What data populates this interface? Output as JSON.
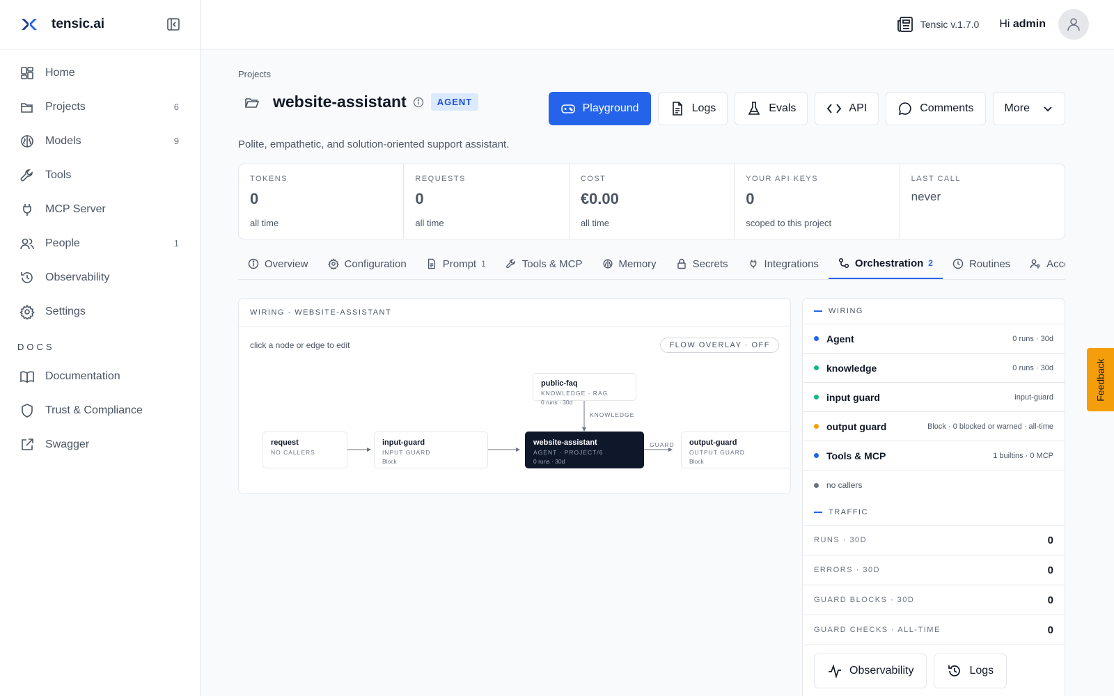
{
  "app": {
    "brand": "tensic.ai"
  },
  "topbar": {
    "version": "Tensic v.1.7.0",
    "greeting_prefix": "Hi",
    "user": "admin"
  },
  "sidebar": {
    "items": [
      {
        "label": "Home",
        "count": "",
        "icon": "home-icon"
      },
      {
        "label": "Projects",
        "count": "6",
        "icon": "folder-icon"
      },
      {
        "label": "Models",
        "count": "9",
        "icon": "brain-icon"
      },
      {
        "label": "Tools",
        "count": "",
        "icon": "wrench-icon"
      },
      {
        "label": "MCP Server",
        "count": "",
        "icon": "plug-icon"
      },
      {
        "label": "People",
        "count": "1",
        "icon": "people-icon"
      },
      {
        "label": "Observability",
        "count": "",
        "icon": "history-icon"
      },
      {
        "label": "Settings",
        "count": "",
        "icon": "gear-icon"
      }
    ],
    "docs_label": "DOCS",
    "docs": [
      {
        "label": "Documentation",
        "icon": "book-icon"
      },
      {
        "label": "Trust & Compliance",
        "icon": "shield-icon"
      },
      {
        "label": "Swagger",
        "icon": "external-link-icon"
      }
    ]
  },
  "main": {
    "breadcrumb": "Projects",
    "title": "website-assistant",
    "badge": "AGENT",
    "description": "Polite, empathetic, and solution-oriented support assistant.",
    "actions": [
      {
        "label": "Playground",
        "icon": "gamepad-icon"
      },
      {
        "label": "Logs",
        "icon": "document-icon"
      },
      {
        "label": "Evals",
        "icon": "flask-icon"
      },
      {
        "label": "API",
        "icon": "code-icon"
      },
      {
        "label": "Comments",
        "icon": "comment-icon"
      },
      {
        "label": "More",
        "icon": "chevron-down-icon"
      }
    ],
    "stats": [
      {
        "label": "TOKENS",
        "value": "0",
        "sub": "all time"
      },
      {
        "label": "REQUESTS",
        "value": "0",
        "sub": "all time"
      },
      {
        "label": "COST",
        "value": "€0.00",
        "sub": "all time"
      },
      {
        "label": "YOUR API KEYS",
        "value": "0",
        "sub": "scoped to this project"
      },
      {
        "label": "LAST CALL",
        "value": "never",
        "sub": ""
      }
    ],
    "tabs": [
      {
        "label": "Overview",
        "count": "",
        "icon": "info-icon"
      },
      {
        "label": "Configuration",
        "count": "",
        "icon": "gear-icon"
      },
      {
        "label": "Prompt",
        "count": "1",
        "icon": "document-icon"
      },
      {
        "label": "Tools & MCP",
        "count": "",
        "icon": "wrench-icon"
      },
      {
        "label": "Memory",
        "count": "",
        "icon": "brain-icon"
      },
      {
        "label": "Secrets",
        "count": "",
        "icon": "lock-icon"
      },
      {
        "label": "Integrations",
        "count": "",
        "icon": "plug-icon"
      },
      {
        "label": "Orchestration",
        "count": "2",
        "icon": "flow-icon"
      },
      {
        "label": "Routines",
        "count": "",
        "icon": "clock-icon"
      },
      {
        "label": "Access",
        "count": "",
        "icon": "user-key-icon"
      }
    ],
    "active_tab": "Orchestration"
  },
  "wiring": {
    "header": "WIRING · WEBSITE-ASSISTANT",
    "hint": "click a node or edge to edit",
    "flow_overlay": "FLOW OVERLAY · OFF",
    "nodes": {
      "request": {
        "title": "request",
        "sub": "NO CALLERS",
        "extra": ""
      },
      "input_guard": {
        "title": "input-guard",
        "sub": "INPUT GUARD",
        "extra": "Block"
      },
      "agent": {
        "title": "website-assistant",
        "sub": "AGENT · PROJECT/6",
        "extra": "0 runs · 30d"
      },
      "output_guard": {
        "title": "output-guard",
        "sub": "OUTPUT GUARD",
        "extra": "Block"
      },
      "faq": {
        "title": "public-faq",
        "sub": "KNOWLEDGE · RAG",
        "extra": "0 runs · 30d"
      }
    },
    "edges": {
      "knowledge": "KNOWLEDGE",
      "guard": "GUARD"
    }
  },
  "panel": {
    "wiring_label": "WIRING",
    "rows": [
      {
        "name": "Agent",
        "meta": "0 runs · 30d",
        "color": "#2563eb"
      },
      {
        "name": "knowledge",
        "meta": "0 runs · 30d",
        "color": "#10b981"
      },
      {
        "name": "input guard",
        "meta": "input-guard",
        "color": "#10b981"
      },
      {
        "name": "output guard",
        "meta": "Block · 0 blocked or warned · all-time",
        "color": "#f59e0b"
      },
      {
        "name": "Tools & MCP",
        "meta": "1 builtins · 0 MCP",
        "color": "#2563eb"
      }
    ],
    "no_callers": "no callers",
    "traffic_label": "TRAFFIC",
    "traffic": [
      {
        "label": "RUNS · 30D",
        "value": "0"
      },
      {
        "label": "ERRORS · 30D",
        "value": "0"
      },
      {
        "label": "GUARD BLOCKS · 30D",
        "value": "0"
      },
      {
        "label": "GUARD CHECKS · ALL-TIME",
        "value": "0"
      }
    ],
    "buttons": [
      {
        "label": "Observability",
        "icon": "pulse-icon"
      },
      {
        "label": "Logs",
        "icon": "history-icon"
      }
    ]
  },
  "feedback": "Feedback",
  "colors": {
    "accent": "#2563eb",
    "sidebar_bg": "#ffffff",
    "feedback": "#f59e0b",
    "agent_node": "#0f172a"
  }
}
